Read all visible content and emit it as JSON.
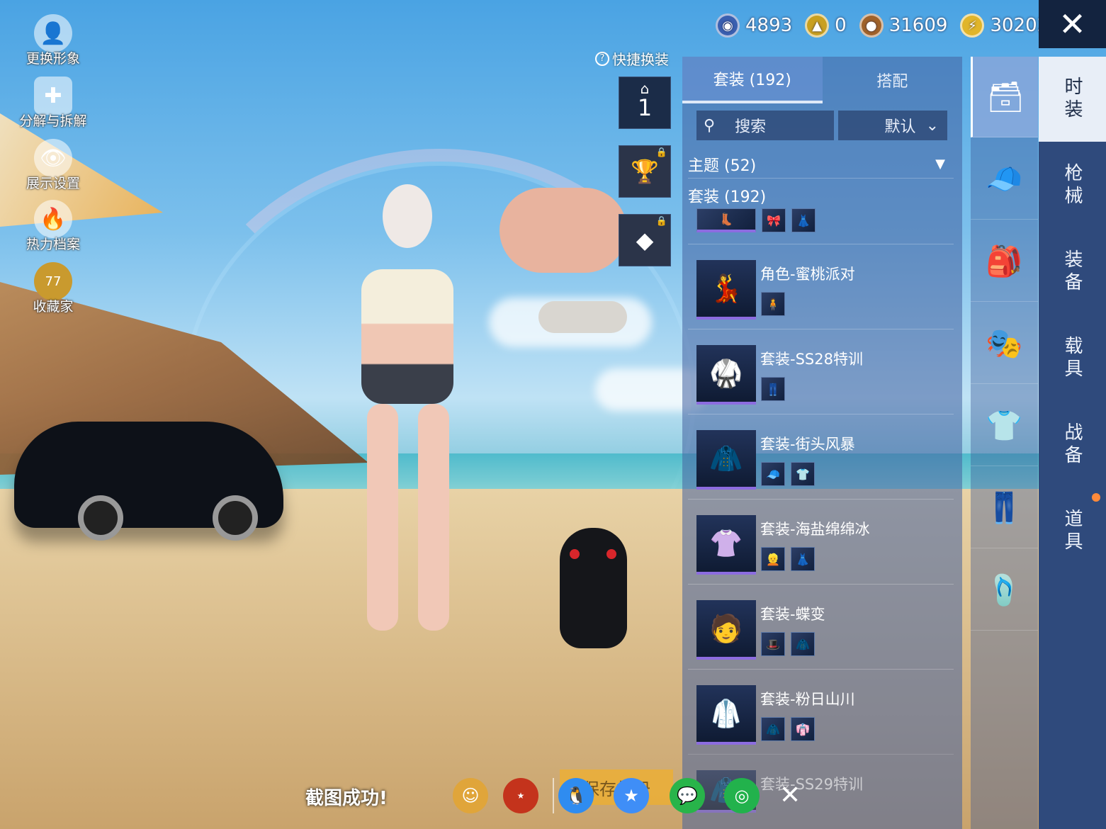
{
  "left_actions": [
    {
      "label": "更换形象",
      "icon": "avatar-icon"
    },
    {
      "label": "分解与拆解",
      "icon": "puzzle-icon"
    },
    {
      "label": "展示设置",
      "icon": "eye-icon"
    },
    {
      "label": "热力档案",
      "icon": "flame-icon"
    },
    {
      "label": "收藏家",
      "icon": "collector-badge-icon",
      "badge": "77"
    }
  ],
  "currencies": [
    {
      "value": "4893",
      "icon": "blue-coin-icon",
      "color": "#3a5fb0"
    },
    {
      "value": "0",
      "icon": "gold-emblem-icon",
      "color": "#c9a020"
    },
    {
      "value": "31609",
      "icon": "bronze-coin-icon",
      "color": "#a0622a"
    },
    {
      "value": "30202",
      "icon": "lightning-coin-icon",
      "color": "#e0b52a"
    }
  ],
  "quick_dress": {
    "label": "快捷换装",
    "slot_number": "1"
  },
  "panel": {
    "tabs": [
      {
        "label": "套装 (192)"
      },
      {
        "label": "搭配"
      }
    ],
    "search_placeholder": "搜索",
    "sort_label": "默认",
    "theme_row": "主题 (52)",
    "set_heading": "套装 (192)",
    "items": [
      {
        "name": "角色-蜜桃派对"
      },
      {
        "name": "套装-SS28特训"
      },
      {
        "name": "套装-街头风暴"
      },
      {
        "name": "套装-海盐绵绵冰"
      },
      {
        "name": "套装-蝶变"
      },
      {
        "name": "套装-粉日山川"
      },
      {
        "name": "套装-SS29特训"
      }
    ]
  },
  "categories": [
    {
      "icon": "outfit-box-icon"
    },
    {
      "icon": "hat-icon"
    },
    {
      "icon": "backpack-icon"
    },
    {
      "icon": "mask-icon"
    },
    {
      "icon": "clothes-icon"
    },
    {
      "icon": "pants-icon"
    },
    {
      "icon": "shoes-icon"
    }
  ],
  "right_tabs": [
    {
      "label": "时装"
    },
    {
      "label": "枪械"
    },
    {
      "label": "装备"
    },
    {
      "label": "载具"
    },
    {
      "label": "战备"
    },
    {
      "label": "道具"
    }
  ],
  "share_bar": {
    "message": "截图成功!",
    "save_label": "保存相册",
    "buttons": [
      {
        "icon": "friends-icon",
        "color": "#e0a53a"
      },
      {
        "icon": "game-elite-icon",
        "color": "#c4331c"
      },
      {
        "icon": "qq-icon",
        "color": "#2f8cf0"
      },
      {
        "icon": "qzone-icon",
        "color": "#3f8ef7"
      },
      {
        "icon": "wechat-icon",
        "color": "#28b44a"
      },
      {
        "icon": "moments-icon",
        "color": "#22b24c"
      }
    ]
  }
}
